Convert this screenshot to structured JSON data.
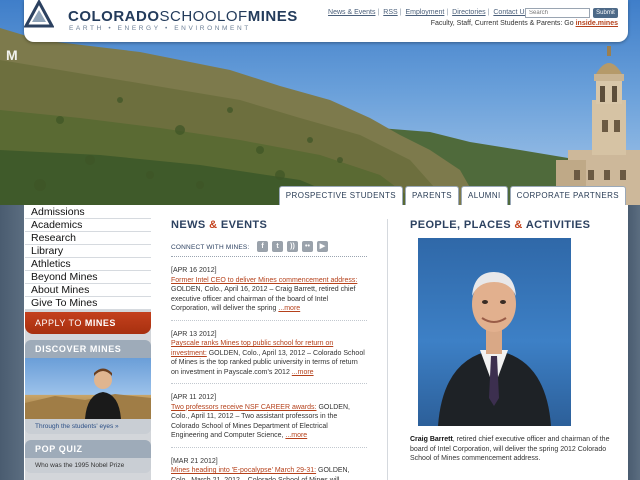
{
  "header": {
    "logo_name_part1": "COLORADO",
    "logo_name_part2": "SCHOOL",
    "logo_name_part3": "OF",
    "logo_name_part4": "MINES",
    "tagline": "EARTH • ENERGY • ENVIRONMENT",
    "util_links": [
      "News & Events",
      "RSS",
      "Employment",
      "Directories",
      "Contact Us"
    ],
    "search": {
      "placeholder": "Search",
      "button": "Submit"
    },
    "insider_prefix": "Faculty, Staff, Current Students & Parents: Go ",
    "insider_link": "inside.mines"
  },
  "audience_tabs": [
    "PROSPECTIVE STUDENTS",
    "PARENTS",
    "ALUMNI",
    "CORPORATE PARTNERS"
  ],
  "sidebar": {
    "nav": [
      "Admissions",
      "Academics",
      "Research",
      "Library",
      "Athletics",
      "Beyond Mines",
      "About Mines",
      "Give To Mines"
    ],
    "apply_prefix": "APPLY TO ",
    "apply_bold": "MINES",
    "discover_title": "DISCOVER MINES",
    "discover_caption": "Through the students' eyes »",
    "quiz_title": "POP QUIZ",
    "quiz_text": "Who was the 1995 Nobel Prize"
  },
  "news": {
    "title_a": "NEWS ",
    "title_amp": "&",
    "title_b": " EVENTS",
    "connect_label": "CONNECT WITH MINES:",
    "items": [
      {
        "date": "[APR 16 2012]",
        "headline": "Former Intel CEO to deliver Mines commencement address:",
        "body": " GOLDEN, Colo., April 16, 2012 – Craig Barrett, retired chief executive officer and chairman of the board of Intel Corporation, will deliver the spring ",
        "more": "...more"
      },
      {
        "date": "[APR 13 2012]",
        "headline": "Payscale ranks Mines top public school for return on investment:",
        "body": " GOLDEN, Colo., April 13, 2012 – Colorado School of Mines is the top ranked public university in terms of return on investment in Payscale.com's 2012 ",
        "more": "...more"
      },
      {
        "date": "[APR 11 2012]",
        "headline": "Two professors receive NSF CAREER awards:",
        "body": " GOLDEN, Colo., April 11, 2012 – Two assistant professors in the Colorado School of Mines Department of Electrical Engineering and Computer Science, ",
        "more": "...more"
      },
      {
        "date": "[MAR 21 2012]",
        "headline": "Mines heading into 'E-pocalypse' March 29-31:",
        "body": " GOLDEN, Colo., March 21, 2012 – Colorado School of Mines will",
        "more": ""
      }
    ]
  },
  "people": {
    "title_a": "PEOPLE, PLACES ",
    "title_amp": "&",
    "title_b": " ACTIVITIES",
    "caption_name": "Craig Barrett",
    "caption_text": ", retired chief executive officer and chairman of the board of Intel Corporation, will deliver the spring 2012 Colorado School of Mines commencement address."
  },
  "colors": {
    "accent": "#c3421d",
    "navy": "#2c4160",
    "link": "#b5411b"
  }
}
